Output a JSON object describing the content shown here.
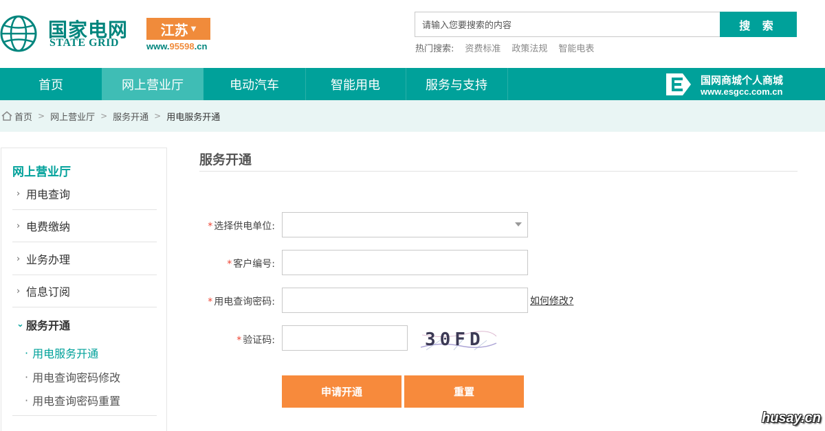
{
  "header": {
    "logo_cn": "国家电网",
    "logo_en": "STATE GRID",
    "region": "江苏",
    "hotline_prefix": "www.",
    "hotline_number": "95598",
    "hotline_suffix": ".cn",
    "search_placeholder": "请输入您要搜索的内容",
    "search_button": "搜 索",
    "hot_label": "热门搜索:",
    "hot_links": [
      "资费标准",
      "政策法规",
      "智能电表"
    ]
  },
  "nav": {
    "items": [
      "首页",
      "网上营业厅",
      "电动汽车",
      "智能用电",
      "服务与支持"
    ],
    "active_index": 1,
    "mall_name": "国网商城个人商城",
    "mall_url": "www.esgcc.com.cn"
  },
  "breadcrumb": [
    "首页",
    "网上营业厅",
    "服务开通",
    "用电服务开通"
  ],
  "sidebar": {
    "title": "网上营业厅",
    "items": [
      "用电查询",
      "电费缴纳",
      "业务办理",
      "信息订阅",
      "服务开通"
    ],
    "sub_items": [
      "用电服务开通",
      "用电查询密码修改",
      "用电查询密码重置"
    ]
  },
  "form": {
    "title": "服务开通",
    "required_mark": "*",
    "supply_label": "选择供电单位:",
    "customer_label": "客户编号:",
    "password_label": "用电查询密码:",
    "howto_link": "如何修改?",
    "captcha_label": "验证码:",
    "captcha_text": "30FD",
    "submit_button": "申请开通",
    "reset_button": "重置"
  },
  "watermark": "husay.cn",
  "colors": {
    "brand_teal": "#00a19a",
    "accent_orange": "#f78a3c"
  }
}
